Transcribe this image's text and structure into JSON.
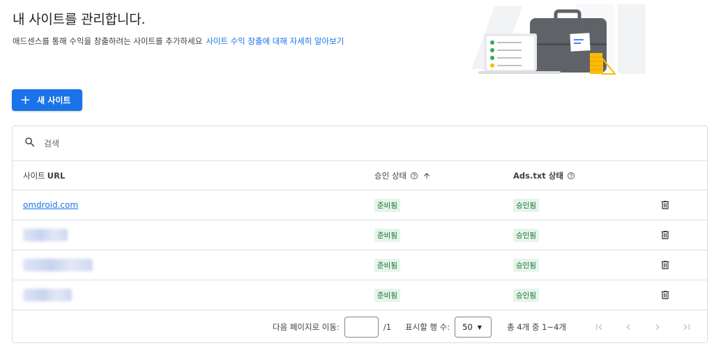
{
  "header": {
    "title": "내 사이트를 관리합니다.",
    "subtitle": "애드센스를 통해 수익을 창출하려는 사이트를 추가하세요",
    "learn_more_link": "사이트 수익 창출에 대해 자세히 알아보기"
  },
  "actions": {
    "add_site_label": "새 사이트",
    "add_site_icon": "plus-icon"
  },
  "search": {
    "placeholder": "검색",
    "value": ""
  },
  "table": {
    "columns": {
      "url_prefix": "사이트",
      "url_suffix": "URL",
      "approval": "승인 상태",
      "ads_txt": "Ads.txt 상태"
    },
    "rows": [
      {
        "url": "omdroid.com",
        "approval": "준비됨",
        "ads_txt": "승인됨",
        "url_hidden": false
      },
      {
        "url": "",
        "approval": "준비됨",
        "ads_txt": "승인됨",
        "url_hidden": true
      },
      {
        "url": "",
        "approval": "준비됨",
        "ads_txt": "승인됨",
        "url_hidden": true
      },
      {
        "url": "",
        "approval": "준비됨",
        "ads_txt": "승인됨",
        "url_hidden": true
      }
    ]
  },
  "pagination": {
    "goto_label": "다음 페이지로 이동:",
    "page_input_value": "",
    "page_total": "/1",
    "rows_label": "표시할 행 수:",
    "rows_value": "50",
    "range_text": "총 4개 중 1~4개"
  },
  "colors": {
    "primary": "#1a73e8",
    "badge_bg": "#e6f4ea",
    "badge_text": "#137333"
  }
}
